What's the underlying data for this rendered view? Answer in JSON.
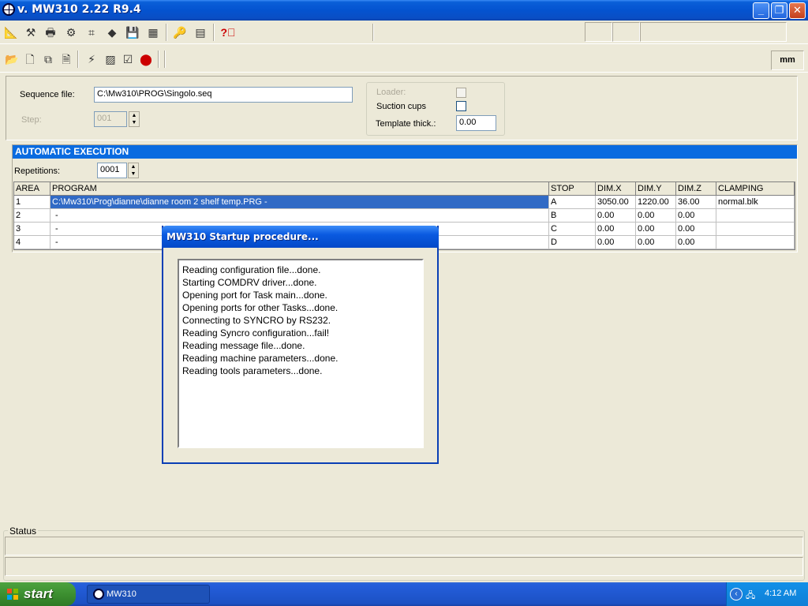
{
  "window": {
    "title": "v. MW310 2.22 R9.4"
  },
  "toolbar": {
    "unit": "mm"
  },
  "sequence": {
    "file_label": "Sequence file:",
    "file_value": "C:\\Mw310\\PROG\\Singolo.seq",
    "step_label": "Step:",
    "step_value": "001"
  },
  "options": {
    "loader_label": "Loader:",
    "suction_label": "Suction cups",
    "template_label": "Template thick.:",
    "template_value": "0.00"
  },
  "automatic": {
    "header": "AUTOMATIC EXECUTION",
    "repetitions_label": "Repetitions:",
    "repetitions_value": "0001",
    "columns": [
      "AREA",
      "PROGRAM",
      "STOP",
      "DIM.X",
      "DIM.Y",
      "DIM.Z",
      "CLAMPING"
    ],
    "rows": [
      [
        "1",
        "C:\\Mw310\\Prog\\dianne\\dianne  room 2  shelf temp.PRG -",
        "A",
        "3050.00",
        "1220.00",
        "36.00",
        "normal.blk"
      ],
      [
        "2",
        "-",
        "B",
        "0.00",
        "0.00",
        "0.00",
        ""
      ],
      [
        "3",
        "-",
        "C",
        "0.00",
        "0.00",
        "0.00",
        ""
      ],
      [
        "4",
        "-",
        "D",
        "0.00",
        "0.00",
        "0.00",
        ""
      ]
    ]
  },
  "dialog": {
    "title": "MW310 Startup procedure...",
    "log": [
      "Reading configuration file...done.",
      "Starting COMDRV driver...done.",
      "Opening port for Task main...done.",
      "Opening ports for other Tasks...done.",
      "Connecting to SYNCRO by RS232.",
      "Reading Syncro configuration...fail!",
      "Reading message file...done.",
      "Reading machine parameters...done.",
      "Reading tools parameters...done."
    ]
  },
  "status": {
    "label": "Status"
  },
  "taskbar": {
    "start_label": "start",
    "task_label": "MW310",
    "clock": "4:12 AM"
  }
}
